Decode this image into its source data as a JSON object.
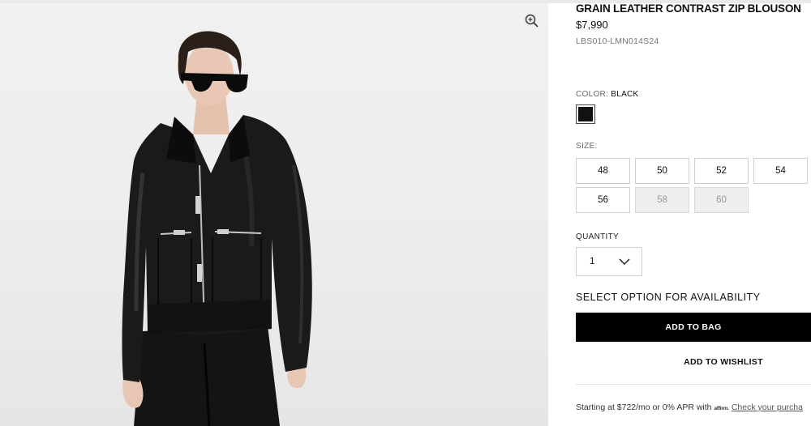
{
  "product": {
    "title": "GRAIN LEATHER CONTRAST ZIP BLOUSON",
    "price": "$7,990",
    "sku": "LBS010-LMN014S24"
  },
  "gallery": {
    "zoom_icon": "zoom-in-icon"
  },
  "color": {
    "label": "COLOR:",
    "value": "BLACK",
    "swatch_color": "#111111"
  },
  "size": {
    "label": "SIZE:",
    "options": [
      {
        "label": "48",
        "available": true
      },
      {
        "label": "50",
        "available": true
      },
      {
        "label": "52",
        "available": true
      },
      {
        "label": "54",
        "available": true
      },
      {
        "label": "56",
        "available": true
      },
      {
        "label": "58",
        "available": false
      },
      {
        "label": "60",
        "available": false
      }
    ]
  },
  "quantity": {
    "label": "QUANTITY",
    "value": "1",
    "icon": "chevron-down-icon"
  },
  "availability_text": "SELECT OPTION FOR AVAILABILITY",
  "actions": {
    "add_to_bag": "ADD TO BAG",
    "add_to_wishlist": "ADD TO WISHLIST"
  },
  "financing": {
    "prefix": "Starting at $722/mo or 0% APR with",
    "brand": "affirm.",
    "link": "Check your purcha"
  },
  "colors": {
    "primary_button": "#000000",
    "unavailable_bg": "#efefef",
    "border": "#cfcfcf"
  }
}
